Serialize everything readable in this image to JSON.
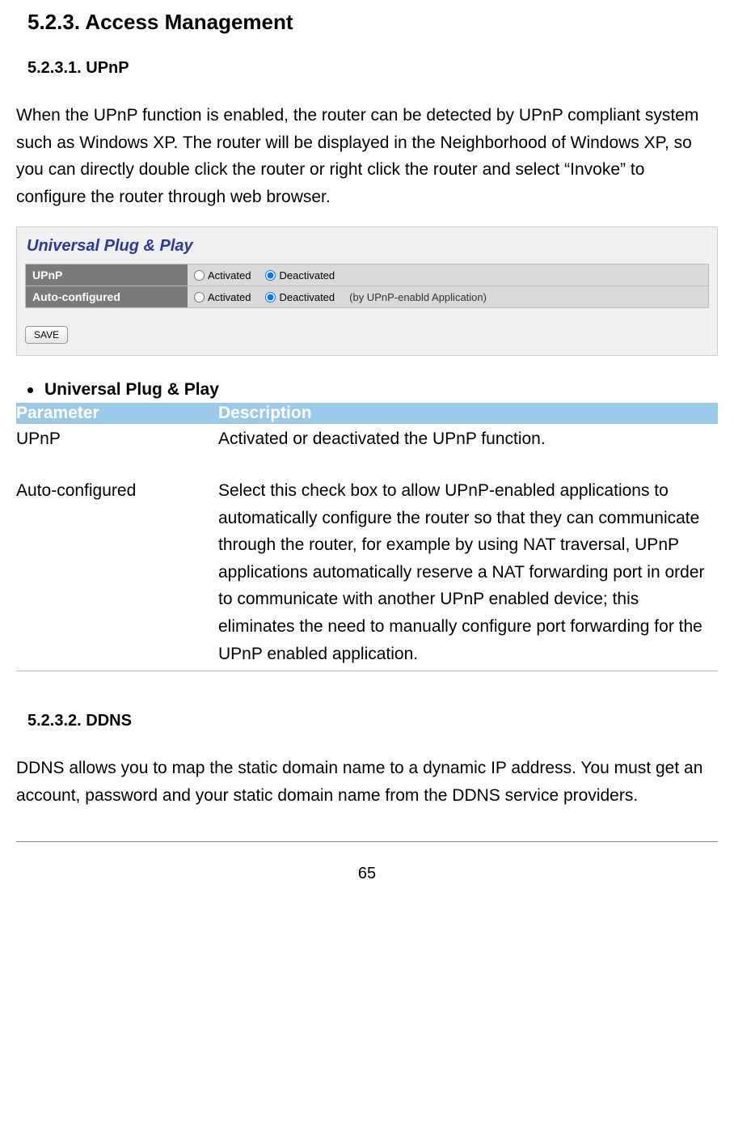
{
  "heading_main": "5.2.3.      Access Management",
  "heading_upnp": "5.2.3.1. UPnP",
  "para_upnp": "When the UPnP function is enabled, the router can be detected by UPnP compliant system such as Windows XP. The router will be displayed in the Neighborhood of Windows XP, so you can directly double click the router or right click the router and select “Invoke” to configure the router through web browser.",
  "panel": {
    "title": "Universal Plug & Play",
    "rows": [
      {
        "label": "UPnP",
        "opt_activated": "Activated",
        "opt_deactivated": "Deactivated",
        "selected": "deactivated",
        "hint": ""
      },
      {
        "label": "Auto-configured",
        "opt_activated": "Activated",
        "opt_deactivated": "Deactivated",
        "selected": "deactivated",
        "hint": "(by UPnP-enabld Application)"
      }
    ],
    "save": "SAVE"
  },
  "bullet_heading": "Universal Plug & Play",
  "table": {
    "header_param": "Parameter",
    "header_desc": "Description",
    "rows": [
      {
        "param": "UPnP",
        "desc": "Activated or deactivated the UPnP function."
      },
      {
        "param": "Auto-configured",
        "desc": "Select this check box to allow UPnP-enabled applications to automatically configure the router so that they can communicate through the router, for example by using NAT traversal, UPnP applications automatically reserve a NAT forwarding port in order to communicate with another UPnP enabled device; this eliminates the need to manually configure port forwarding for the UPnP enabled application."
      }
    ]
  },
  "heading_ddns": "5.2.3.2. DDNS",
  "para_ddns": "DDNS allows you to map the static domain name to a dynamic IP address. You must get an account, password and your static domain name from the DDNS service providers.",
  "page_number": "65"
}
